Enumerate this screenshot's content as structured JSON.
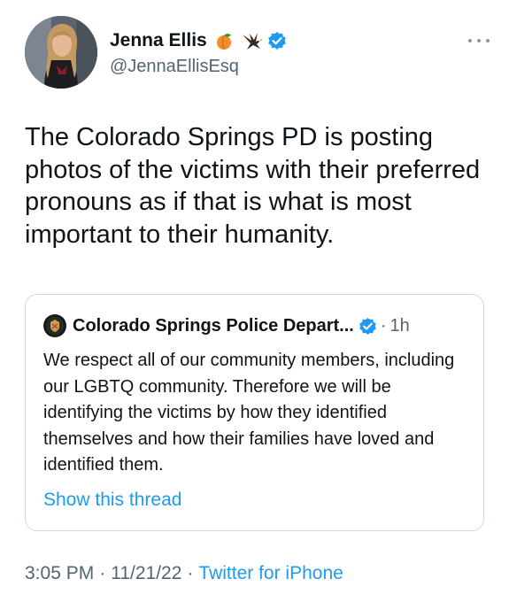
{
  "author": {
    "name": "Jenna Ellis",
    "handle": "@JennaEllisEsq",
    "emoji": [
      "peach-emoji",
      "eagle-emoji"
    ],
    "verified": true
  },
  "tweet": {
    "text": "The Colorado Springs PD is posting photos of the victims with their preferred pronouns as if that is what is most important to their humanity."
  },
  "quoted_tweet": {
    "author_name": "Colorado Springs Police Depart...",
    "verified": true,
    "separator": "·",
    "time": "1h",
    "text": "We respect all of our community members, including our LGBTQ community. Therefore we will be identifying the victims by how they identified themselves and how their families have loved and identified them.",
    "show_thread_label": "Show this thread"
  },
  "meta": {
    "time": "3:05 PM",
    "date": "11/21/22",
    "separator": "·",
    "source": "Twitter for iPhone"
  },
  "colors": {
    "link": "#1d9bf0",
    "secondary_text": "#536471",
    "border": "#cfd9de",
    "verified_badge": "#1d9bf0"
  }
}
